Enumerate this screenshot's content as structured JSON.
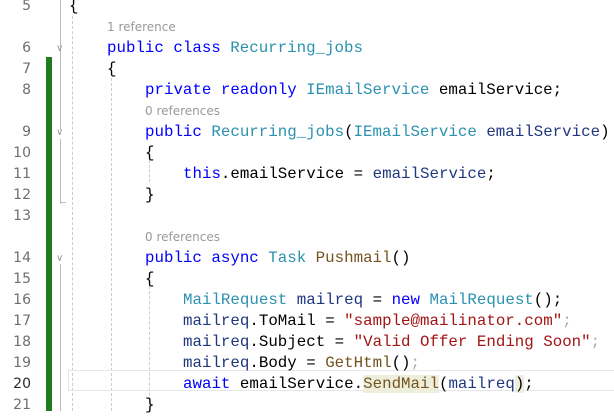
{
  "editor": {
    "lines": [
      {
        "num": "5",
        "indent": 1,
        "tokens": [
          [
            "{",
            ""
          ]
        ]
      },
      {
        "lens": "1 reference",
        "indent": 2
      },
      {
        "num": "6",
        "indent": 2,
        "fold": true,
        "tokens": [
          [
            "public",
            "kw"
          ],
          [
            " ",
            ""
          ],
          [
            "class",
            "kw"
          ],
          [
            " ",
            ""
          ],
          [
            "Recurring_jobs",
            "ty"
          ]
        ]
      },
      {
        "num": "7",
        "indent": 2,
        "tokens": [
          [
            "{",
            ""
          ]
        ]
      },
      {
        "num": "8",
        "indent": 3,
        "tokens": [
          [
            "private",
            "kw"
          ],
          [
            " ",
            ""
          ],
          [
            "readonly",
            "kw"
          ],
          [
            " ",
            ""
          ],
          [
            "IEmailService",
            "ty"
          ],
          [
            " emailService;",
            ""
          ]
        ]
      },
      {
        "lens": "0 references",
        "indent": 3
      },
      {
        "num": "9",
        "indent": 3,
        "fold": true,
        "tokens": [
          [
            "public",
            "kw"
          ],
          [
            " ",
            ""
          ],
          [
            "Recurring_jobs",
            "ty"
          ],
          [
            "(",
            ""
          ],
          [
            "IEmailService",
            "ty"
          ],
          [
            " ",
            ""
          ],
          [
            "emailService",
            "v"
          ],
          [
            ")",
            ""
          ]
        ]
      },
      {
        "num": "10",
        "indent": 3,
        "tokens": [
          [
            "{",
            ""
          ]
        ]
      },
      {
        "num": "11",
        "indent": 4,
        "tokens": [
          [
            "this",
            "kw"
          ],
          [
            ".emailService = ",
            ""
          ],
          [
            "emailService",
            "v"
          ],
          [
            ";",
            ""
          ]
        ]
      },
      {
        "num": "12",
        "indent": 3,
        "tokens": [
          [
            "}",
            ""
          ]
        ]
      },
      {
        "num": "13",
        "indent": 3,
        "tokens": []
      },
      {
        "lens": "0 references",
        "indent": 3
      },
      {
        "num": "14",
        "indent": 3,
        "fold": true,
        "tokens": [
          [
            "public",
            "kw"
          ],
          [
            " ",
            ""
          ],
          [
            "async",
            "kw"
          ],
          [
            " ",
            ""
          ],
          [
            "Task",
            "ty"
          ],
          [
            " ",
            ""
          ],
          [
            "Pushmail",
            "m"
          ],
          [
            "()",
            ""
          ]
        ]
      },
      {
        "num": "15",
        "indent": 3,
        "tokens": [
          [
            "{",
            ""
          ]
        ]
      },
      {
        "num": "16",
        "indent": 4,
        "tokens": [
          [
            "MailRequest",
            "ty"
          ],
          [
            " ",
            ""
          ],
          [
            "mailreq",
            "v"
          ],
          [
            " = ",
            ""
          ],
          [
            "new",
            "kw"
          ],
          [
            " ",
            ""
          ],
          [
            "MailRequest",
            "ty"
          ],
          [
            "();",
            ""
          ]
        ]
      },
      {
        "num": "17",
        "indent": 4,
        "tokens": [
          [
            "mailreq",
            "v"
          ],
          [
            ".ToMail = ",
            ""
          ],
          [
            "\"sample@mailinator.com\"",
            "str"
          ],
          [
            ";",
            "fade"
          ]
        ]
      },
      {
        "num": "18",
        "indent": 4,
        "tokens": [
          [
            "mailreq",
            "v"
          ],
          [
            ".Subject = ",
            ""
          ],
          [
            "\"Valid Offer Ending Soon\"",
            "str"
          ],
          [
            ";",
            "fade"
          ]
        ]
      },
      {
        "num": "19",
        "indent": 4,
        "tokens": [
          [
            "mailreq",
            "v"
          ],
          [
            ".Body = ",
            ""
          ],
          [
            "GetHtml",
            "m"
          ],
          [
            "()",
            ""
          ],
          [
            ";",
            "fade"
          ]
        ]
      },
      {
        "num": "20",
        "indent": 4,
        "current": true,
        "tokens": [
          [
            "await",
            "kw"
          ],
          [
            " emailService.",
            ""
          ],
          [
            "SendMail",
            "m hl"
          ],
          [
            "(",
            ""
          ],
          [
            "mailreq",
            "v"
          ],
          [
            ")",
            "hl"
          ],
          [
            ";",
            ""
          ]
        ]
      },
      {
        "num": "21",
        "indent": 3,
        "tokens": [
          [
            "}",
            ""
          ]
        ]
      }
    ]
  },
  "colors": {
    "change_bar": "#1e7d1e",
    "keyword": "#0000ff",
    "type": "#2b91af",
    "string": "#a31515",
    "method": "#74531f"
  }
}
